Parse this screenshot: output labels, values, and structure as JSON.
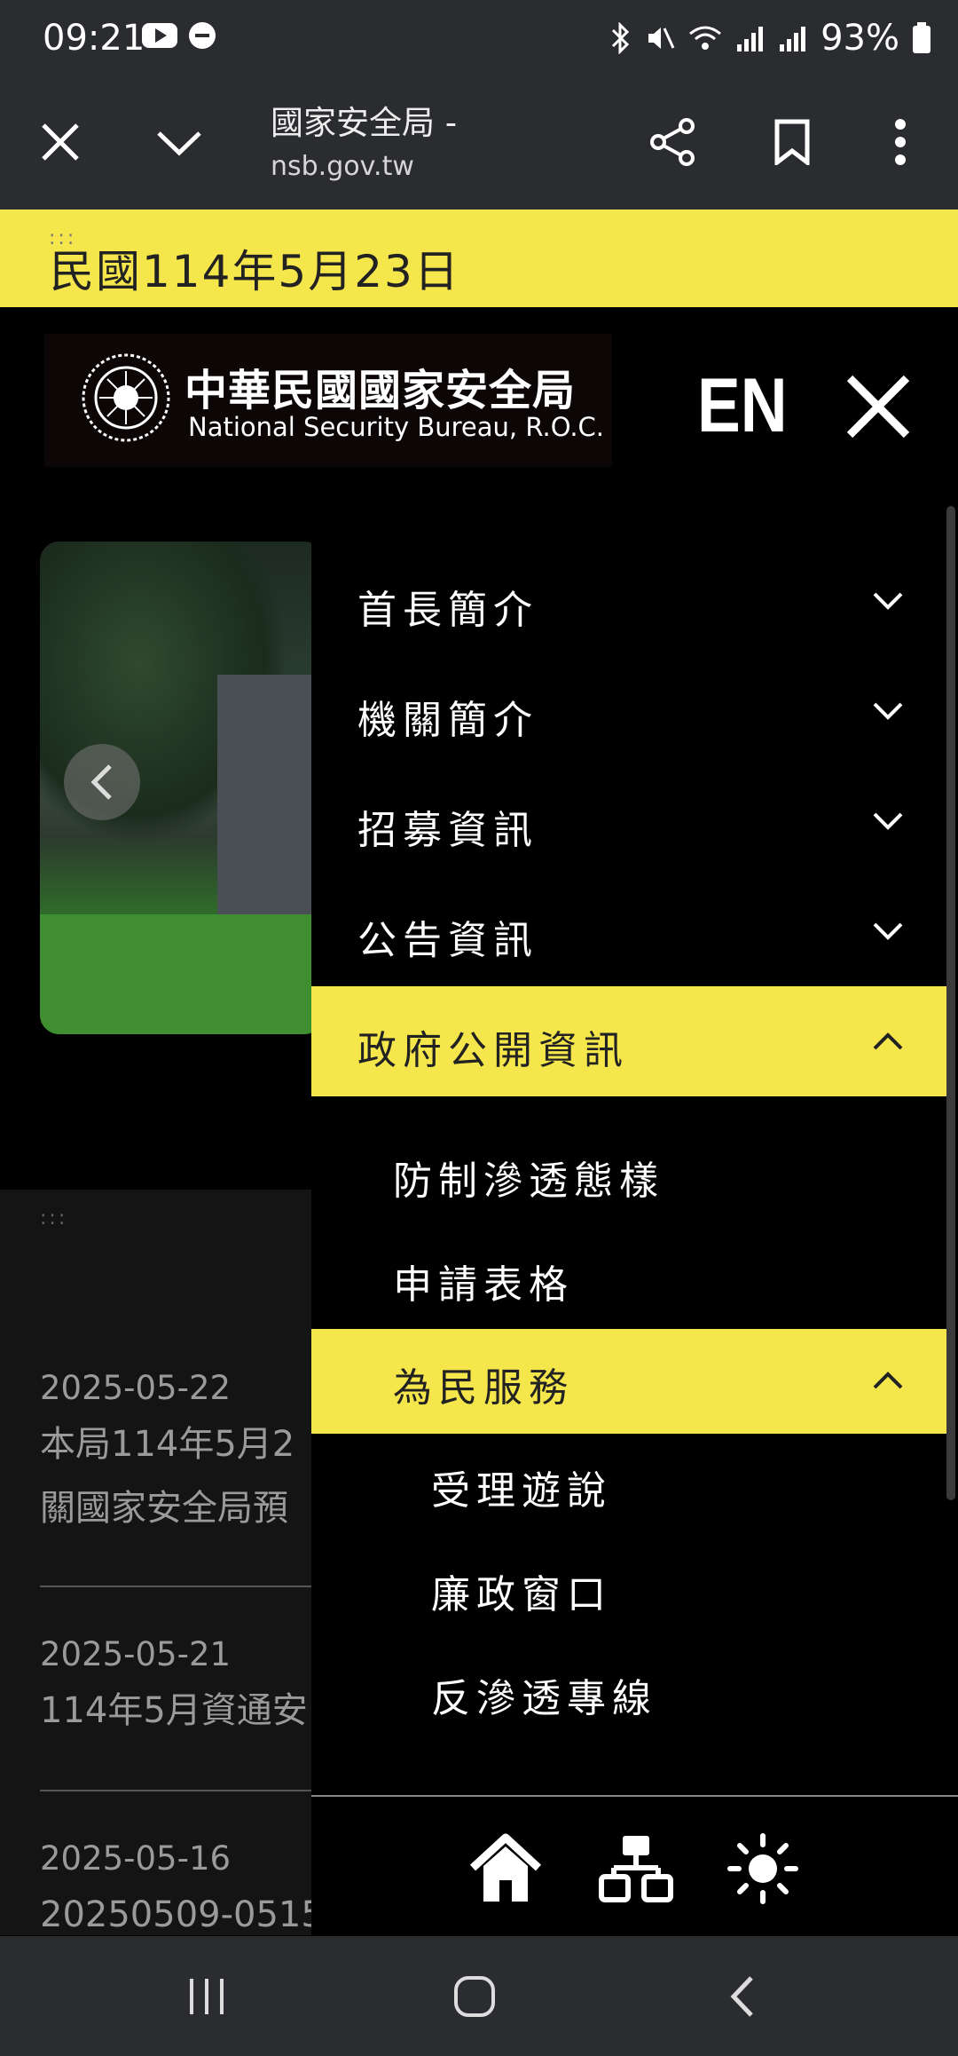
{
  "status_bar": {
    "time": "09:21",
    "battery": "93%"
  },
  "browser": {
    "title": "國家安全局 -",
    "url": "nsb.gov.tw"
  },
  "date_bar": {
    "dots": ":::",
    "text": "民國114年5月23日"
  },
  "header": {
    "logo_zh": "中華民國國家安全局",
    "logo_en": "National Security Bureau, R.O.C.",
    "lang_button": "EN"
  },
  "menu": {
    "items": [
      {
        "label": "首長簡介",
        "expanded": false
      },
      {
        "label": "機關簡介",
        "expanded": false
      },
      {
        "label": "招募資訊",
        "expanded": false
      },
      {
        "label": "公告資訊",
        "expanded": false
      },
      {
        "label": "政府公開資訊",
        "expanded": true
      }
    ],
    "sub_items": [
      {
        "label": "防制滲透態樣"
      },
      {
        "label": "申請表格"
      },
      {
        "label": "為民服務",
        "expanded": true
      }
    ],
    "sub_sub_items": [
      {
        "label": "受理遊說"
      },
      {
        "label": "廉政窗口"
      },
      {
        "label": "反滲透專線"
      }
    ],
    "footer_icons": [
      "home-icon",
      "sitemap-icon",
      "theme-toggle-icon"
    ]
  },
  "news": {
    "dots": ":::",
    "items": [
      {
        "date": "2025-05-22",
        "title_line1": "本局114年5月2",
        "title_line2": "關國家安全局預"
      },
      {
        "date": "2025-05-21",
        "title_line1": "114年5月資通安"
      },
      {
        "date": "2025-05-16",
        "title_line1": "20250509-0515"
      }
    ]
  },
  "colors": {
    "accent_yellow": "#f5e64b",
    "bar_gray": "#2b2c30"
  }
}
